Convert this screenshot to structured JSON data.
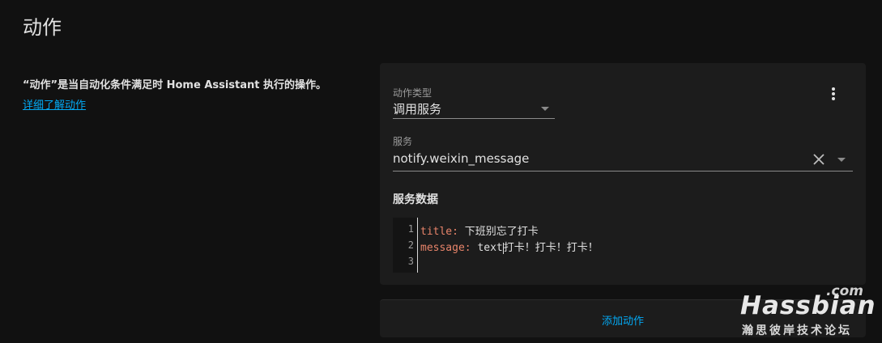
{
  "page": {
    "title": "动作"
  },
  "intro": {
    "description": "“动作”是当自动化条件满足时 Home Assistant 执行的操作。",
    "learn_more": "详细了解动作"
  },
  "action": {
    "type_label": "动作类型",
    "type_value": "调用服务",
    "service_label": "服务",
    "service_value": "notify.weixin_message",
    "data_title": "服务数据",
    "code": {
      "line_numbers": [
        "1",
        "2",
        "3"
      ],
      "line1_key": "title",
      "line1_sep": ": ",
      "line1_value": "下班别忘了打卡",
      "line2_key": "message",
      "line2_sep": ": ",
      "line2_value_a": "text",
      "line2_value_b": "打卡！打卡！打卡！"
    }
  },
  "add_action_label": "添加动作",
  "watermark": {
    "com": ".com",
    "main": "Hassbian",
    "sub": "瀚思彼岸技术论坛"
  },
  "colors": {
    "accent": "#03a9f4",
    "yaml_key": "#e8846a",
    "card_bg": "#1c1c1c",
    "page_bg": "#111111"
  },
  "icons": {
    "menu": "more-vertical-icon",
    "clear": "close-icon",
    "dropdown": "caret-down-icon"
  }
}
